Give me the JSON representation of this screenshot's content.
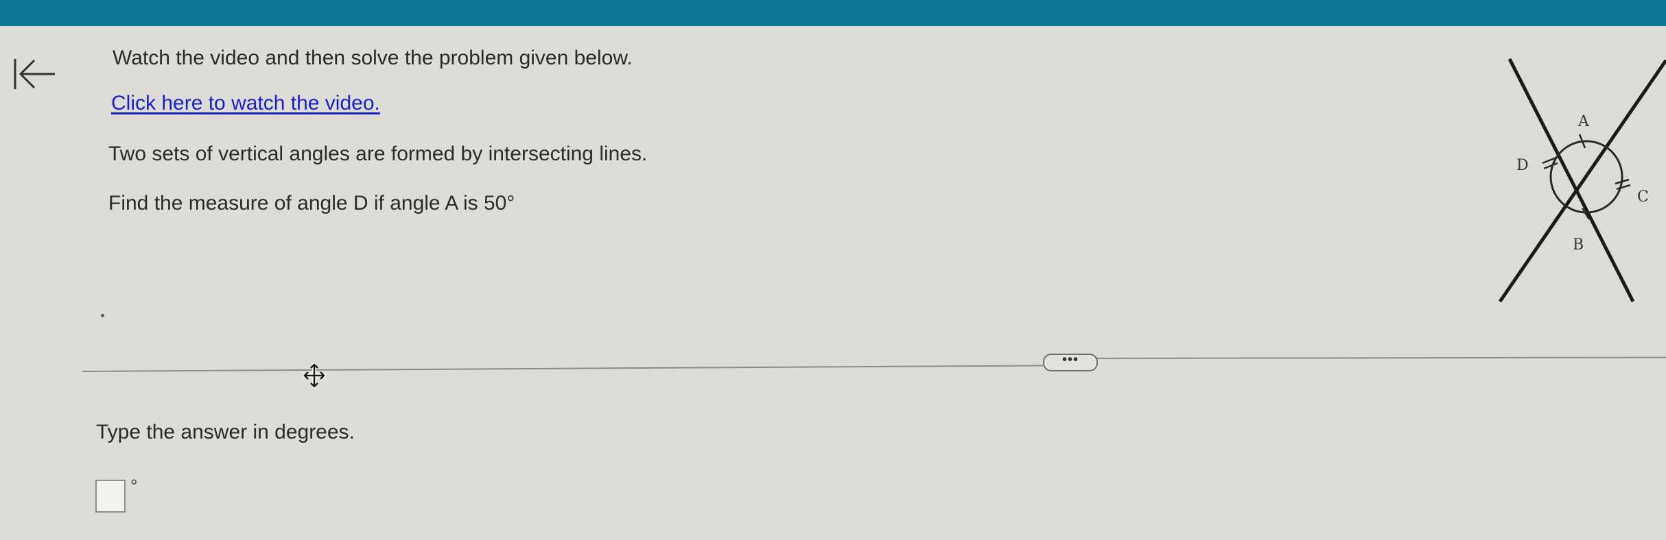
{
  "header": {
    "color": "#0b7696"
  },
  "nav": {
    "back_icon": "arrow-left-to-bar-icon"
  },
  "question": {
    "instruction": "Watch the video and then solve the problem given below.",
    "video_link": "Click here to watch the video.",
    "problem_line_1": "Two sets of vertical angles are formed by intersecting lines.",
    "problem_line_2": "Find the measure of angle D if angle A is 50°"
  },
  "diagram": {
    "labels": {
      "a": "A",
      "b": "B",
      "c": "C",
      "d": "D"
    }
  },
  "toolbar": {
    "more_label": "•••"
  },
  "answer": {
    "label": "Type the answer in degrees.",
    "value": "",
    "unit": "°"
  }
}
